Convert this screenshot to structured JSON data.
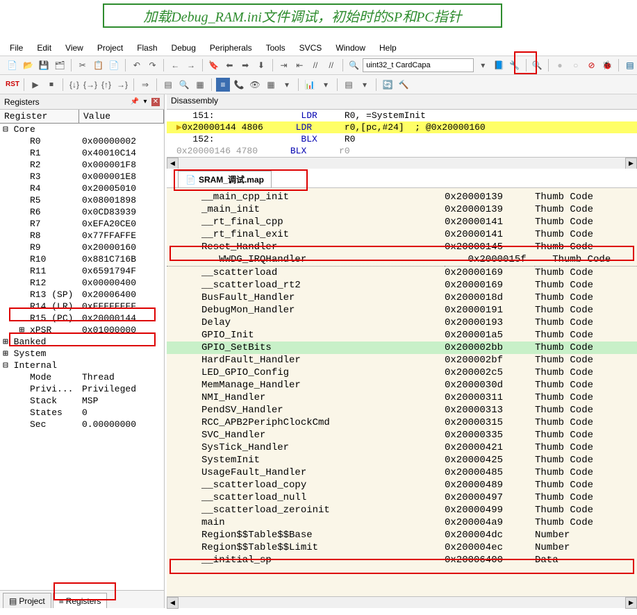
{
  "annotation": "加载Debug_RAM.ini文件调试，初始时的SP和PC指针",
  "menu": {
    "items": [
      "File",
      "Edit",
      "View",
      "Project",
      "Flash",
      "Debug",
      "Peripherals",
      "Tools",
      "SVCS",
      "Window",
      "Help"
    ]
  },
  "toolbar1": {
    "combo": "uint32_t CardCapa"
  },
  "registers_panel": {
    "title": "Registers",
    "header": {
      "c1": "Register",
      "c2": "Value"
    },
    "groups": {
      "core": "Core",
      "banked": "Banked",
      "system": "System",
      "internal": "Internal",
      "xpsr": "xPSR"
    },
    "rows": [
      {
        "name": "R0",
        "val": "0x00000002"
      },
      {
        "name": "R1",
        "val": "0x40010C14"
      },
      {
        "name": "R2",
        "val": "0x000001F8"
      },
      {
        "name": "R3",
        "val": "0x000001E8"
      },
      {
        "name": "R4",
        "val": "0x20005010"
      },
      {
        "name": "R5",
        "val": "0x08001898"
      },
      {
        "name": "R6",
        "val": "0x0CD83939"
      },
      {
        "name": "R7",
        "val": "0xEFA20CE0"
      },
      {
        "name": "R8",
        "val": "0x77FFAFFE"
      },
      {
        "name": "R9",
        "val": "0x20000160"
      },
      {
        "name": "R10",
        "val": "0x881C716B"
      },
      {
        "name": "R11",
        "val": "0x6591794F"
      },
      {
        "name": "R12",
        "val": "0x00000400"
      },
      {
        "name": "R13 (SP)",
        "val": "0x20006400"
      },
      {
        "name": "R14 (LR)",
        "val": "0xFFFFFFFF"
      },
      {
        "name": "R15 (PC)",
        "val": "0x20000144"
      }
    ],
    "xpsr_val": "0x01000000",
    "internal": [
      {
        "name": "Mode",
        "val": "Thread"
      },
      {
        "name": "Privi...",
        "val": "Privileged"
      },
      {
        "name": "Stack",
        "val": "MSP"
      },
      {
        "name": "States",
        "val": "0"
      },
      {
        "name": "Sec",
        "val": "0.00000000"
      }
    ],
    "tabs": {
      "project": "Project",
      "registers": "Registers"
    }
  },
  "disassembly": {
    "title": "Disassembly",
    "lines": [
      {
        "addr": "   151:",
        "op": "                LDR",
        "args": "     R0, =SystemInit"
      },
      {
        "addr": "0x20000144 4806",
        "op": "      LDR",
        "args": "      r0,[pc,#24]  ; @0x20000160",
        "hl": true
      },
      {
        "addr": "   152:",
        "op": "                BLX",
        "args": "     R0"
      },
      {
        "addr": "0x20000146 4780",
        "op": "      BLX",
        "args": "      r0"
      }
    ]
  },
  "file_tab": "SRAM_调试.map",
  "map": {
    "rows": [
      {
        "sym": "__main_cpp_init",
        "addr": "0x20000139",
        "type": "Thumb Code"
      },
      {
        "sym": "_main_init",
        "addr": "0x20000139",
        "type": "Thumb Code"
      },
      {
        "sym": "__rt_final_cpp",
        "addr": "0x20000141",
        "type": "Thumb Code"
      },
      {
        "sym": "__rt_final_exit",
        "addr": "0x20000141",
        "type": "Thumb Code"
      },
      {
        "sym": "Reset_Handler",
        "addr": "0x20000145",
        "type": "Thumb Code"
      },
      {
        "sym": "   WWDG_IRQHandler",
        "addr": "    0x2000015f",
        "type": "   Thumb Code",
        "dotted": true
      },
      {
        "sym": "__scatterload",
        "addr": "0x20000169",
        "type": "Thumb Code"
      },
      {
        "sym": "__scatterload_rt2",
        "addr": "0x20000169",
        "type": "Thumb Code"
      },
      {
        "sym": "BusFault_Handler",
        "addr": "0x2000018d",
        "type": "Thumb Code"
      },
      {
        "sym": "DebugMon_Handler",
        "addr": "0x20000191",
        "type": "Thumb Code"
      },
      {
        "sym": "Delay",
        "addr": "0x20000193",
        "type": "Thumb Code"
      },
      {
        "sym": "GPIO_Init",
        "addr": "0x200001a5",
        "type": "Thumb Code"
      },
      {
        "sym": "GPIO_SetBits",
        "addr": "0x200002bb",
        "type": "Thumb Code",
        "green": true
      },
      {
        "sym": "HardFault_Handler",
        "addr": "0x200002bf",
        "type": "Thumb Code"
      },
      {
        "sym": "LED_GPIO_Config",
        "addr": "0x200002c5",
        "type": "Thumb Code"
      },
      {
        "sym": "MemManage_Handler",
        "addr": "0x2000030d",
        "type": "Thumb Code"
      },
      {
        "sym": "NMI_Handler",
        "addr": "0x20000311",
        "type": "Thumb Code"
      },
      {
        "sym": "PendSV_Handler",
        "addr": "0x20000313",
        "type": "Thumb Code"
      },
      {
        "sym": "RCC_APB2PeriphClockCmd",
        "addr": "0x20000315",
        "type": "Thumb Code"
      },
      {
        "sym": "SVC_Handler",
        "addr": "0x20000335",
        "type": "Thumb Code"
      },
      {
        "sym": "SysTick_Handler",
        "addr": "0x20000421",
        "type": "Thumb Code"
      },
      {
        "sym": "SystemInit",
        "addr": "0x20000425",
        "type": "Thumb Code"
      },
      {
        "sym": "UsageFault_Handler",
        "addr": "0x20000485",
        "type": "Thumb Code"
      },
      {
        "sym": "__scatterload_copy",
        "addr": "0x20000489",
        "type": "Thumb Code"
      },
      {
        "sym": "__scatterload_null",
        "addr": "0x20000497",
        "type": "Thumb Code"
      },
      {
        "sym": "__scatterload_zeroinit",
        "addr": "0x20000499",
        "type": "Thumb Code"
      },
      {
        "sym": "main",
        "addr": "0x200004a9",
        "type": "Thumb Code"
      },
      {
        "sym": "Region$$Table$$Base",
        "addr": "0x200004dc",
        "type": "Number"
      },
      {
        "sym": "Region$$Table$$Limit",
        "addr": "0x200004ec",
        "type": "Number"
      },
      {
        "sym": "__initial_sp",
        "addr": "0x20006400",
        "type": "Data"
      }
    ]
  }
}
